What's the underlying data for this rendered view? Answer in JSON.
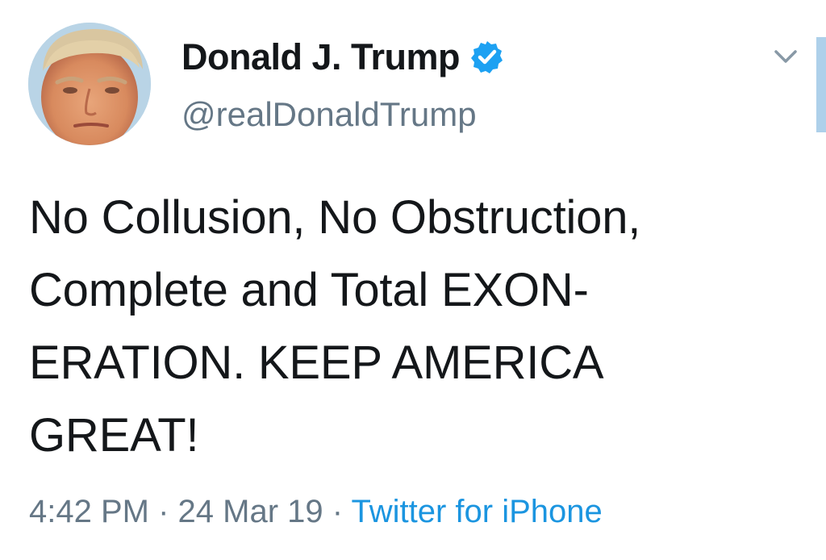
{
  "user": {
    "display_name": "Donald J. Trump",
    "handle": "@realDonaldTrump",
    "verified": true,
    "avatar_icon": "profile-photo"
  },
  "tweet": {
    "text_lines": [
      "No Collusion, No Obstruction,",
      "Complete and Total EXON-",
      "ERATION. KEEP AMERICA",
      "GREAT!"
    ]
  },
  "meta": {
    "time": "4:42 PM",
    "separator": "·",
    "date": "24 Mar 19",
    "source": "Twitter for iPhone"
  },
  "icons": {
    "verified": "verified-badge-icon",
    "menu": "chevron-down-icon"
  },
  "colors": {
    "name": "#14171a",
    "secondary": "#657786",
    "link": "#1b95e0",
    "verified": "#1da1f2"
  }
}
